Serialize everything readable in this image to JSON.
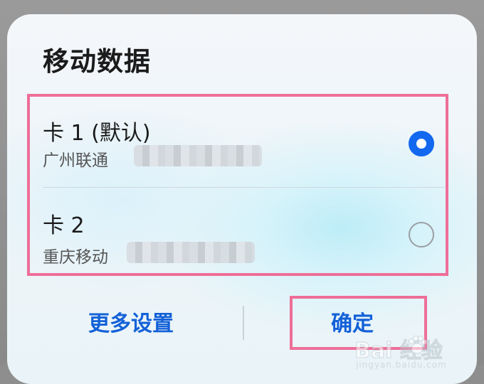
{
  "dialog": {
    "title": "移动数据",
    "options": [
      {
        "name": "卡 1 (默认)",
        "carrier": "广州联通",
        "selected": true
      },
      {
        "name": "卡 2",
        "carrier": "重庆移动",
        "selected": false
      }
    ],
    "buttons": {
      "more_settings": "更多设置",
      "confirm": "确定"
    }
  },
  "watermark": {
    "main": "Bai  经验",
    "sub": "jingyan.baidu.com"
  },
  "colors": {
    "accent": "#1268ef",
    "button_text": "#1361d8",
    "highlight_box": "#ee6e98"
  }
}
